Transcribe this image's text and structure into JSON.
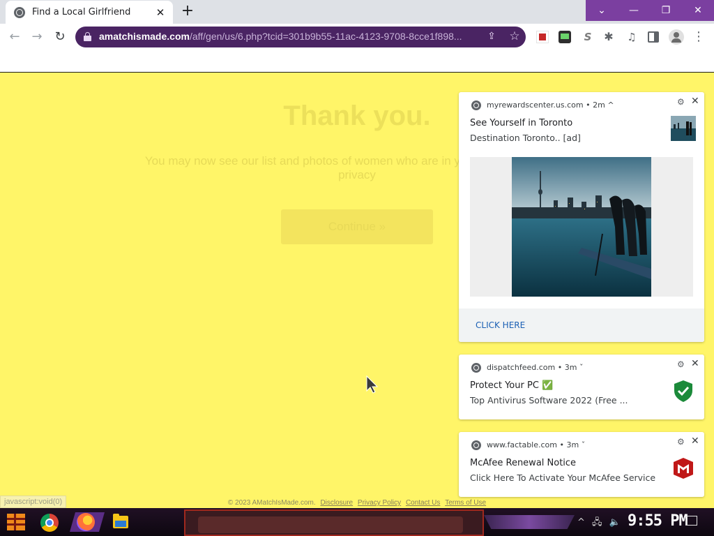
{
  "browser": {
    "tab": {
      "title": "Find a Local Girlfriend",
      "close": "✕"
    },
    "new_tab": "+",
    "window_controls": {
      "tab_search": "⌄",
      "minimize": "—",
      "restore": "❐",
      "close": "✕"
    },
    "nav": {
      "back": "←",
      "forward": "→",
      "reload": "↻"
    },
    "url": {
      "host": "amatchismade.com",
      "path": "/aff/gen/us/6.php?tcid=301b9b55-11ac-4123-9708-8cce1f898..."
    },
    "share_icon": "⇪",
    "star_icon": "☆",
    "ext_icons": {
      "puzzle": "✱",
      "media": "♫",
      "menu": "⋮",
      "s": "S"
    }
  },
  "page": {
    "headline": "Thank you.",
    "subtext_line1": "You may now see our list and photos of women who are in your area and meet y",
    "subtext_line2": "privacy",
    "continue_label": "Continue »",
    "status_url": "javascript:void(0)",
    "footer": {
      "copyright": "© 2023 AMatchIsMade.com.",
      "links": [
        "Disclosure",
        "Privacy Policy",
        "Contact Us",
        "Terms of Use"
      ]
    }
  },
  "notifications": [
    {
      "origin": "myrewardscenter.us.com",
      "age": "2m",
      "chevron": "^",
      "title": "See Yourself in Toronto",
      "body": "Destination Toronto.. [ad]",
      "action": "CLICK HERE"
    },
    {
      "origin": "dispatchfeed.com",
      "age": "3m",
      "chevron": "ˇ",
      "title": "Protect Your PC ✅",
      "body": "Top Antivirus Software 2022 (Free ..."
    },
    {
      "origin": "www.factable.com",
      "age": "3m",
      "chevron": "ˇ",
      "title": "McAfee Renewal Notice",
      "body": "Click Here To Activate Your McAfee Service"
    }
  ],
  "notification_controls": {
    "gear": "⚙",
    "close": "✕",
    "dot": "•"
  },
  "taskbar": {
    "clock": "9:55 PM",
    "tray_icons": {
      "chevron": "^",
      "network": "🖧",
      "volume": "🔈"
    }
  },
  "colors": {
    "page_bg": "#fff568",
    "browser_accent": "#7b3fa0",
    "omnibox": "#4a2463"
  }
}
